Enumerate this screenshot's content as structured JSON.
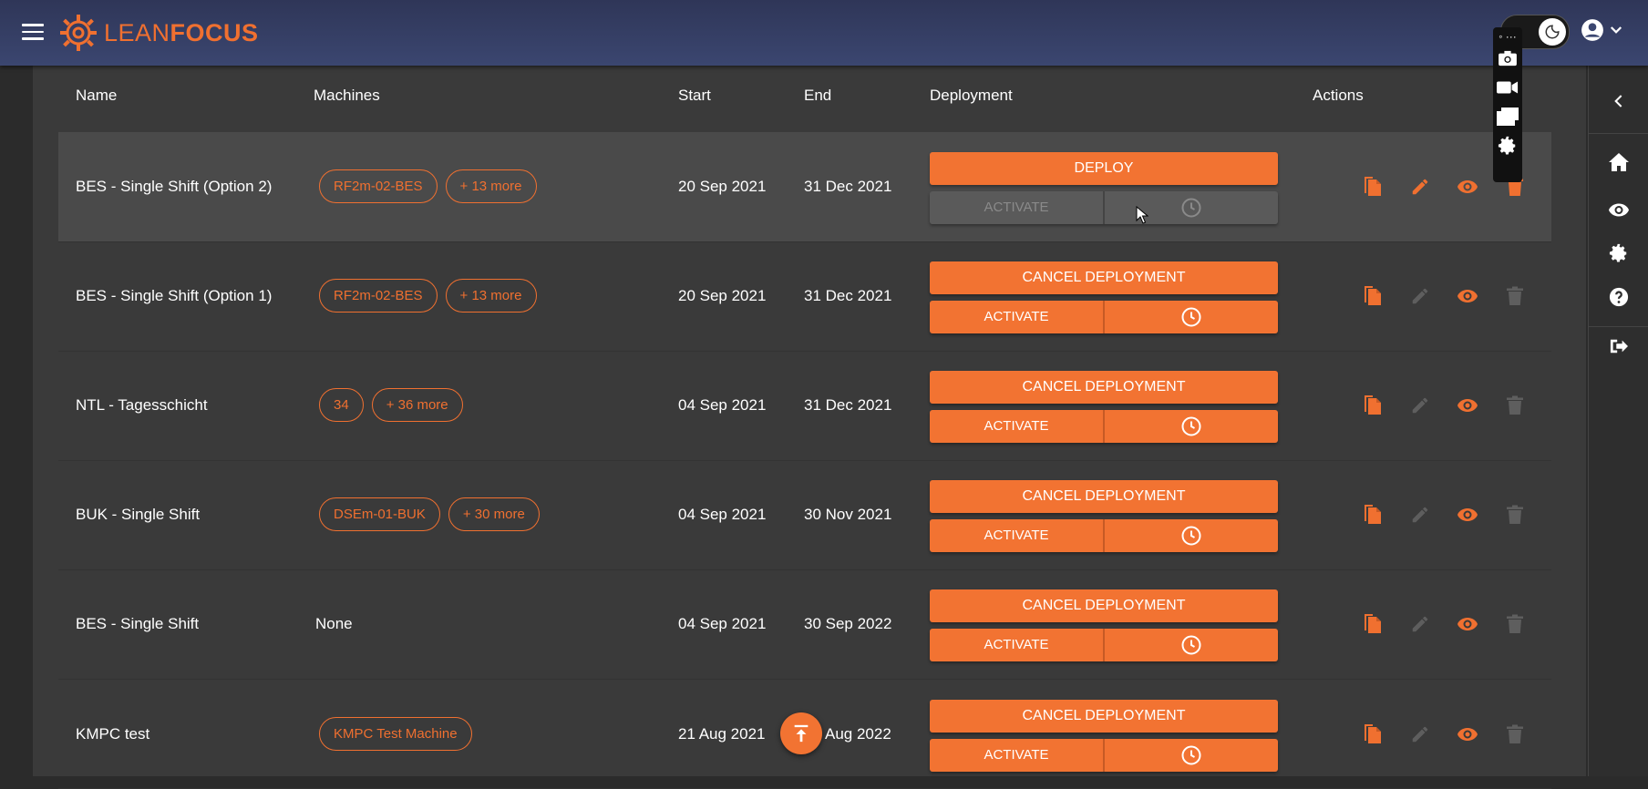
{
  "app": {
    "logo_part1": "LEAN",
    "logo_part2": "FOCUS",
    "brand_color": "#f07030",
    "topbar_color": "#343d63"
  },
  "toolstrip": {
    "dots": "◦ ···"
  },
  "table": {
    "headers": {
      "name": "Name",
      "machines": "Machines",
      "start": "Start",
      "end": "End",
      "deployment": "Deployment",
      "actions": "Actions"
    },
    "rows": [
      {
        "name": "BES - Single Shift (Option 2)",
        "machines": [
          "RF2m-02-BES",
          "+ 13 more"
        ],
        "start": "20 Sep 2021",
        "end": "31 Dec 2021",
        "primary": "DEPLOY",
        "activate": "ACTIVATE",
        "activate_disabled": true,
        "edit_enabled": true
      },
      {
        "name": "BES - Single Shift (Option 1)",
        "machines": [
          "RF2m-02-BES",
          "+ 13 more"
        ],
        "start": "20 Sep 2021",
        "end": "31 Dec 2021",
        "primary": "CANCEL DEPLOYMENT",
        "activate": "ACTIVATE",
        "activate_disabled": false,
        "edit_enabled": false
      },
      {
        "name": "NTL - Tagesschicht",
        "machines": [
          "34",
          "+ 36 more"
        ],
        "start": "04 Sep 2021",
        "end": "31 Dec 2021",
        "primary": "CANCEL DEPLOYMENT",
        "activate": "ACTIVATE",
        "activate_disabled": false,
        "edit_enabled": false
      },
      {
        "name": "BUK - Single Shift",
        "machines": [
          "DSEm-01-BUK",
          "+ 30 more"
        ],
        "start": "04 Sep 2021",
        "end": "30 Nov 2021",
        "primary": "CANCEL DEPLOYMENT",
        "activate": "ACTIVATE",
        "activate_disabled": false,
        "edit_enabled": false
      },
      {
        "name": "BES - Single Shift",
        "machines_text": "None",
        "start": "04 Sep 2021",
        "end": "30 Sep 2022",
        "primary": "CANCEL DEPLOYMENT",
        "activate": "ACTIVATE",
        "activate_disabled": false,
        "edit_enabled": false
      },
      {
        "name": "KMPC test",
        "machines": [
          "KMPC Test Machine"
        ],
        "start": "21 Aug 2021",
        "end": "Aug 2022",
        "primary": "CANCEL DEPLOYMENT",
        "activate": "ACTIVATE",
        "activate_disabled": false,
        "edit_enabled": false
      }
    ]
  },
  "icons": {
    "copy": "copy-icon",
    "edit": "pencil-icon",
    "view": "eye-icon",
    "delete": "trash-icon",
    "clock": "clock-icon",
    "home": "home-icon",
    "settings": "gear-icon",
    "help": "help-icon",
    "logout": "logout-icon",
    "collapse": "chevron-left-icon",
    "scroll_top": "arrow-up-icon"
  }
}
